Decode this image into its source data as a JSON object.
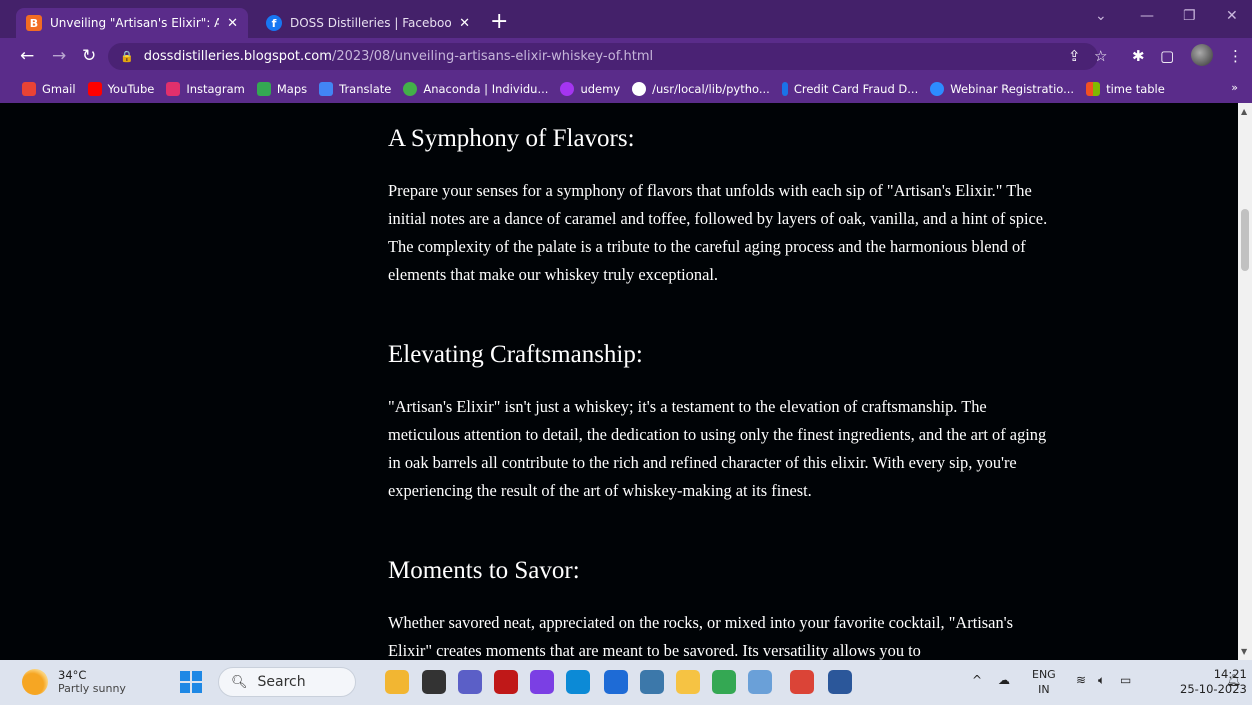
{
  "tabs": [
    {
      "title": "Unveiling \"Artisan's Elixir\": A Wh",
      "favicon": "B",
      "favicon_color": "#f26c23"
    },
    {
      "title": "DOSS Distilleries | Facebook",
      "favicon": "f",
      "favicon_color": "#1877f2"
    }
  ],
  "omnibox": {
    "host": "dossdistilleries.blogspot.com",
    "path": "/2023/08/unveiling-artisans-elixir-whiskey-of.html"
  },
  "bookmarks": [
    {
      "label": "Gmail",
      "color": "#ea4335"
    },
    {
      "label": "YouTube",
      "color": "#ff0000"
    },
    {
      "label": "Instagram",
      "color": "#e1306c"
    },
    {
      "label": "Maps",
      "color": "#34a853"
    },
    {
      "label": "Translate",
      "color": "#4285f4"
    },
    {
      "label": "Anaconda | Individu...",
      "color": "#43b049"
    },
    {
      "label": "udemy",
      "color": "#a435f0"
    },
    {
      "label": "/usr/local/lib/pytho...",
      "color": "#ffffff"
    },
    {
      "label": "Credit Card Fraud D...",
      "color": "#1a73e8"
    },
    {
      "label": "Webinar Registratio...",
      "color": "#2d8cff"
    },
    {
      "label": "time table",
      "color": "#fbbc04"
    }
  ],
  "article": {
    "sections": [
      {
        "heading": "A Symphony of Flavors:",
        "body": "Prepare your senses for a symphony of flavors that unfolds with each sip of \"Artisan's Elixir.\" The initial notes are a dance of caramel and toffee, followed by layers of oak, vanilla, and a hint of spice. The complexity of the palate is a tribute to the careful aging process and the harmonious blend of elements that make our whiskey truly exceptional."
      },
      {
        "heading": "Elevating Craftsmanship:",
        "body": "\"Artisan's Elixir\" isn't just a whiskey; it's a testament to the elevation of craftsmanship. The meticulous attention to detail, the dedication to using only the finest ingredients, and the art of aging in oak barrels all contribute to the rich and refined character of this elixir. With every sip, you're experiencing the result of the art of whiskey-making at its finest."
      },
      {
        "heading": "Moments to Savor:",
        "body": "Whether savored neat, appreciated on the rocks, or mixed into your favorite cocktail, \"Artisan's Elixir\" creates moments that are meant to be savored. Its versatility allows you to"
      }
    ]
  },
  "taskbar": {
    "weather_temp": "34°C",
    "weather_cond": "Partly sunny",
    "search_label": "Search",
    "lang_top": "ENG",
    "lang_bottom": "IN",
    "time": "14:21",
    "date": "25-10-2023",
    "apps": [
      {
        "name": "files-icon",
        "color": "#f2b632"
      },
      {
        "name": "task-view-icon",
        "color": "#333333"
      },
      {
        "name": "chat-icon",
        "color": "#5b5fc7"
      },
      {
        "name": "mcafee-icon",
        "color": "#c01818"
      },
      {
        "name": "mylo-icon",
        "color": "#7b3fe4"
      },
      {
        "name": "edge-icon",
        "color": "#0c8ad6"
      },
      {
        "name": "store-icon",
        "color": "#1e6bd6"
      },
      {
        "name": "python-icon",
        "color": "#3c78aa"
      },
      {
        "name": "explorer-icon",
        "color": "#f6c343"
      },
      {
        "name": "chrome-alt-icon",
        "color": "#34a853"
      },
      {
        "name": "notepad-icon",
        "color": "#6aa0d8"
      },
      {
        "name": "chrome-icon",
        "color": "#db4437"
      },
      {
        "name": "word-icon",
        "color": "#2b579a"
      }
    ]
  }
}
